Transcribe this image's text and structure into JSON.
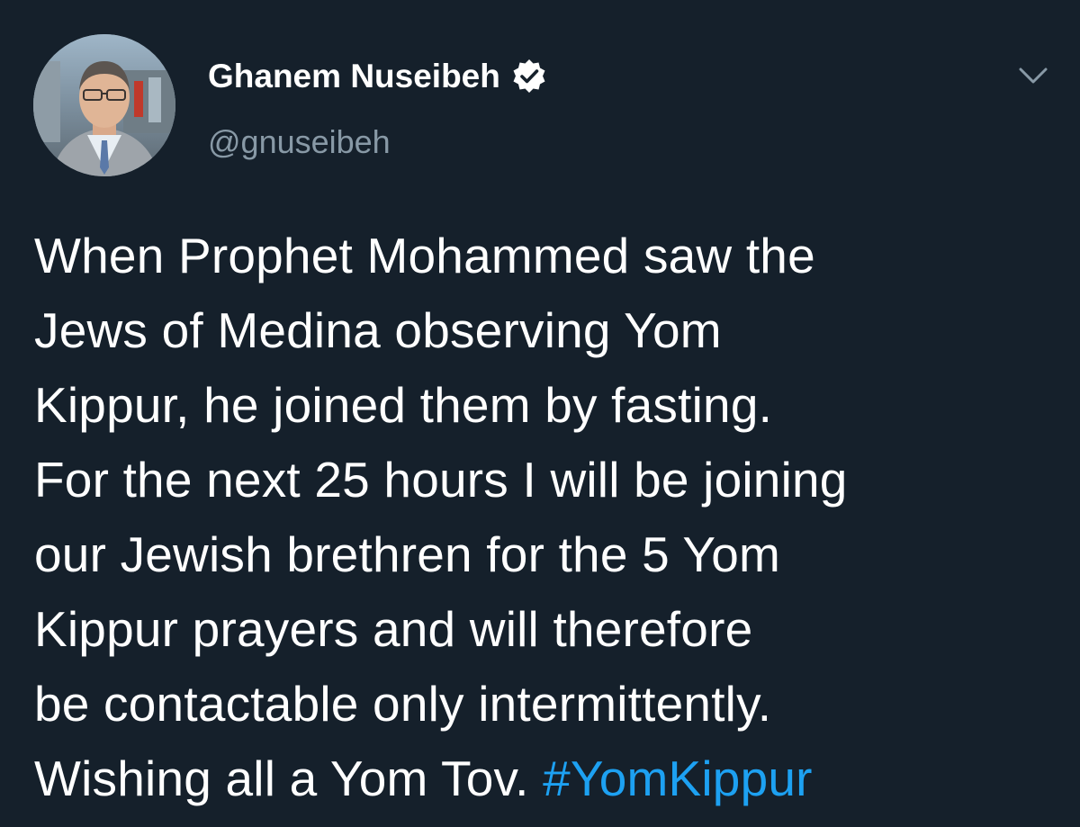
{
  "author": {
    "display_name": "Ghanem Nuseibeh",
    "handle": "@gnuseibeh",
    "verified": true,
    "avatar_icon": "profile-photo"
  },
  "tweet": {
    "lines": [
      "When Prophet Mohammed saw the",
      "Jews of Medina observing Yom",
      "Kippur, he joined them by fasting.",
      "For the next 25 hours I will be joining",
      "our Jewish brethren for the 5 Yom",
      "Kippur prayers and will therefore",
      "be contactable only intermittently."
    ],
    "last_line_text": "Wishing all a Yom Tov. ",
    "hashtag": "#YomKippur"
  },
  "menu_icon": "chevron-down-icon",
  "colors": {
    "background": "#15202b",
    "text": "#ffffff",
    "secondary_text": "#8899a6",
    "link": "#1da1f2"
  }
}
